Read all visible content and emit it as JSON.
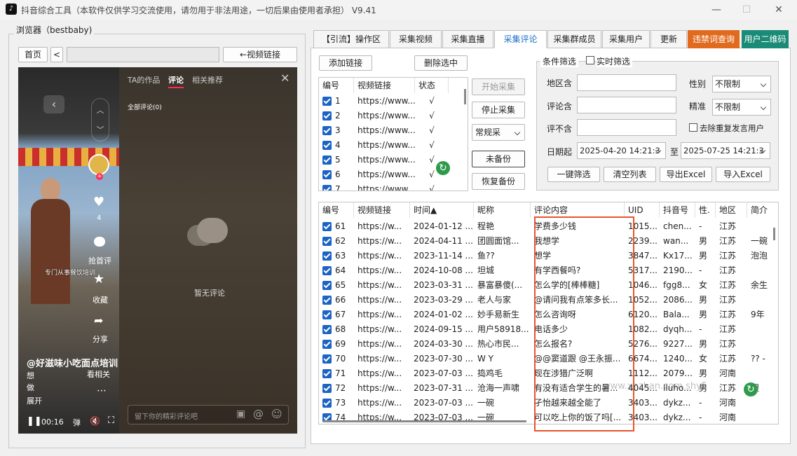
{
  "window": {
    "title": "抖音综合工具（本软件仅供学习交流使用，请勿用于非法用途，一切后果由使用者承担）  V9.41",
    "minimize": "—",
    "maximize": "☐",
    "close": "✕",
    "app_icon": "♪"
  },
  "browser": {
    "label": "浏览器（bestbaby)",
    "home": "首页",
    "back": "<",
    "video_link": "←视频链接",
    "url": ""
  },
  "phone": {
    "tabs": [
      "TA的作品",
      "评论",
      "相关推荐"
    ],
    "all_comments": "全部评论(0)",
    "no_comments": "暂无评论",
    "input_placeholder": "留下你的精彩评论吧",
    "time": "00:16",
    "author": "@好滋味小吃面点培训",
    "desc": "想\n做",
    "expand": "展开",
    "likes": "4",
    "grab_first": "抢首评",
    "collect": "收藏",
    "share": "分享",
    "related": "看相关",
    "banner_text": "专门从事餐饮培训"
  },
  "tabs": [
    {
      "label": "【引流】操作区"
    },
    {
      "label": "采集视频"
    },
    {
      "label": "采集直播"
    },
    {
      "label": "采集评论",
      "active": true
    },
    {
      "label": "采集群成员"
    },
    {
      "label": "采集用户"
    },
    {
      "label": "更新"
    },
    {
      "label": "违禁词查询",
      "color": "#e06a1e"
    },
    {
      "label": "用户二维码",
      "color": "#1a8b76"
    }
  ],
  "links": {
    "add": "添加链接",
    "delete": "删除选中",
    "headers": [
      "编号",
      "视频链接",
      "状态"
    ],
    "rows": [
      [
        "1",
        "https://www...",
        "√"
      ],
      [
        "2",
        "https://www...",
        "√"
      ],
      [
        "3",
        "https://www...",
        "√"
      ],
      [
        "4",
        "https://www...",
        "√"
      ],
      [
        "5",
        "https://www...",
        "√"
      ],
      [
        "6",
        "https://www...",
        "√"
      ],
      [
        "7",
        "https://www...",
        "√"
      ]
    ]
  },
  "actions": {
    "start": "开始采集",
    "stop": "停止采集",
    "mode": "常规采",
    "backup": "未备份",
    "restore": "恢复备份"
  },
  "filter": {
    "title": "条件筛选",
    "realtime": "实时筛选",
    "region": "地区含",
    "comment_in": "评论含",
    "comment_not": "评不含",
    "date_from": "日期起",
    "date_from_val": "2025-04-20 14:21:3",
    "to": "至",
    "date_to_val": "2025-07-25 14:21:3",
    "gender": "性别",
    "gender_val": "不限制",
    "precise": "精准",
    "precise_val": "不限制",
    "dedupe": "去除重复发言用户",
    "one_click": "一键筛选",
    "clear": "清空列表",
    "export": "导出Excel",
    "import": "导入Excel"
  },
  "comments": {
    "headers": [
      "编号",
      "视频链接",
      "时间▲",
      "昵称",
      "评论内容",
      "UID",
      "抖音号",
      "性.",
      "地区",
      "简介"
    ],
    "rows": [
      [
        "61",
        "https://w...",
        "2024-01-12 ...",
        "程艳",
        "学费多少钱",
        "1015...",
        "chen...",
        "-",
        "江苏",
        ""
      ],
      [
        "62",
        "https://w...",
        "2024-04-11 ...",
        "团圆面馆...",
        "我想学",
        "2239...",
        "wan...",
        "男",
        "江苏",
        "一碗"
      ],
      [
        "63",
        "https://w...",
        "2023-11-14 ...",
        "鱼??",
        "想学",
        "3847...",
        "Kx17...",
        "男",
        "江苏",
        "泡泡"
      ],
      [
        "64",
        "https://w...",
        "2024-10-08 ...",
        "坦城",
        "有学西餐吗?",
        "5317...",
        "2190...",
        "-",
        "江苏",
        ""
      ],
      [
        "65",
        "https://w...",
        "2023-03-31 ...",
        "暴富暴傻(...",
        "怎么学的[棒棒糖]",
        "1046...",
        "fgg8...",
        "女",
        "江苏",
        "余生"
      ],
      [
        "66",
        "https://w...",
        "2023-03-29 ...",
        "老人与家",
        "@请问我有点笨多长...",
        "1052...",
        "2086...",
        "男",
        "江苏",
        ""
      ],
      [
        "67",
        "https://w...",
        "2024-01-02 ...",
        "妙手易新生",
        "怎么咨询呀",
        "6120...",
        "Bala...",
        "男",
        "江苏",
        "9年"
      ],
      [
        "68",
        "https://w...",
        "2024-09-15 ...",
        "用户58918...",
        "电话多少",
        "1082...",
        "dyqh...",
        "-",
        "江苏",
        ""
      ],
      [
        "69",
        "https://w...",
        "2024-03-30 ...",
        "热心市民...",
        "怎么报名?",
        "5276...",
        "9227...",
        "男",
        "江苏",
        ""
      ],
      [
        "70",
        "https://w...",
        "2023-07-30 ...",
        "W Y",
        "@@窦道跟 @王永振...",
        "6674...",
        "1240...",
        "女",
        "江苏",
        "?? -"
      ],
      [
        "71",
        "https://w...",
        "2023-07-03 ...",
        "捣鸡毛",
        "现在涉猎广泛啊",
        "1112...",
        "2079...",
        "男",
        "河南",
        ""
      ],
      [
        "72",
        "https://w...",
        "2023-07-31 ...",
        "沧海一声啸",
        "有没有适合学生的暑...",
        "4045...",
        "lluho...",
        "男",
        "江苏",
        "跟"
      ],
      [
        "73",
        "https://w...",
        "2023-07-03 ...",
        "一碗",
        "孑怡越来越全能了",
        "3403...",
        "dykz...",
        "-",
        "河南",
        ""
      ],
      [
        "74",
        "https://w...",
        "2023-07-03 ...",
        "一碗",
        "可以吃上你的饭了吗[...",
        "3403...",
        "dykz...",
        "-",
        "河南",
        ""
      ]
    ]
  },
  "watermark": "www.xhzhan.com shy5"
}
